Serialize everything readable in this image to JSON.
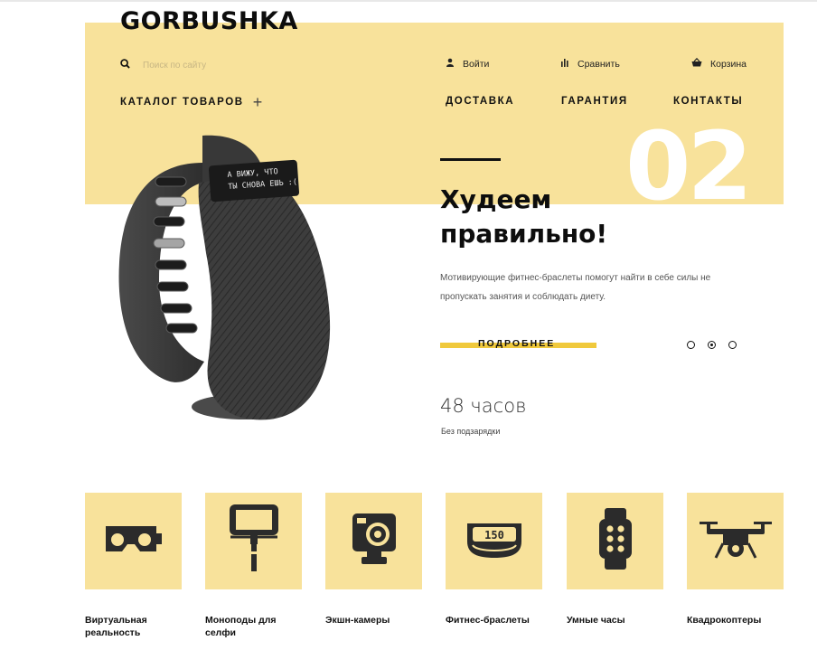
{
  "brand": {
    "logo": "GORBUSHKA"
  },
  "colors": {
    "accent_bg": "#f8e29b",
    "accent_bar": "#f0c93c",
    "text": "#111111"
  },
  "search": {
    "placeholder": "Поиск по сайту",
    "icon": "search-icon"
  },
  "utilities": {
    "login": {
      "label": "Войти",
      "icon": "user-icon"
    },
    "compare": {
      "label": "Сравнить",
      "icon": "bars-icon"
    },
    "cart": {
      "label": "Корзина",
      "icon": "basket-icon"
    }
  },
  "nav": {
    "catalog": "КАТАЛОГ ТОВАРОВ",
    "catalog_toggle": "+",
    "delivery": "ДОСТАВКА",
    "warranty": "ГАРАНТИЯ",
    "contacts": "КОНТАКТЫ"
  },
  "slide": {
    "number": "02",
    "headline": "Худеем правильно!",
    "description": "Мотивирующие фитнес-браслеты помогут найти в себе силы не пропускать занятия и соблюдать диету.",
    "cta": "ПОДРОБНЕЕ",
    "device_screen": [
      "А ВИЖУ, ЧТО",
      "ТЫ СНОВА ЕШЬ :("
    ],
    "stat_value": "48 часов",
    "stat_label": "Без подзарядки",
    "active_dot": 1,
    "dot_count": 3
  },
  "categories": [
    {
      "label": "Виртуальная реальность",
      "icon": "vr-headset-icon"
    },
    {
      "label": "Моноподы для селфи",
      "icon": "selfie-stick-icon"
    },
    {
      "label": "Экшн-камеры",
      "icon": "action-camera-icon"
    },
    {
      "label": "Фитнес-браслеты",
      "icon": "fitness-band-icon",
      "icon_text": "150"
    },
    {
      "label": "Умные часы",
      "icon": "smartwatch-icon"
    },
    {
      "label": "Квадрокоптеры",
      "icon": "drone-icon"
    }
  ]
}
